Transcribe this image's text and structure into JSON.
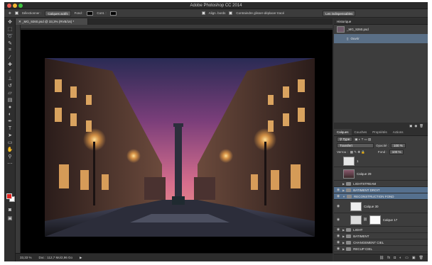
{
  "window": {
    "title": "Adobe Photoshop CC 2014"
  },
  "options": {
    "select_label": "Sélectionner :",
    "select_value": "Calques actifs",
    "fill_label": "Fond :",
    "stroke_label": "Cont. :",
    "align_label": "Align. bords",
    "constrain_label": "Contraindre glisser-déplacer tracé",
    "workspace_value": "Les indispensables"
  },
  "document": {
    "tab_title": "_MG_9260.psd @ 33,3% (RVB/16) *",
    "zoom": "33,33 %",
    "doc_info": "Doc : 112,7 Mo/2,96 Go"
  },
  "history": {
    "tab": "Historique",
    "snapshot": "_MG_9260.psd",
    "step": "Ouvrir"
  },
  "layers_panel": {
    "tabs": [
      "Calques",
      "Couches",
      "Propriétés",
      "Actions"
    ],
    "filter_value": "Type",
    "blend_value": "Transfert",
    "opacity_label": "Opacité :",
    "opacity_value": "100 %",
    "lock_label": "Verrou :",
    "fill_label": "Fond :",
    "fill_value": "100 %",
    "layers": [
      {
        "name": "1",
        "type": "layer",
        "thumb": "#e6e6e6",
        "selected": false
      },
      {
        "name": "Calque 29",
        "type": "layer",
        "thumb": "#7a4a4a",
        "selected": false
      },
      {
        "name": "LIGHTSTREAM",
        "type": "group",
        "selected": false
      },
      {
        "name": "BATIMENT DROIT",
        "type": "group",
        "selected": true
      },
      {
        "name": "RECONSTRUCTION FOND",
        "type": "group",
        "selected": true
      },
      {
        "name": "Calque 30",
        "type": "layer",
        "thumb": "#eeeeee",
        "selected": false
      },
      {
        "name": "Calque 17",
        "type": "masked",
        "thumb": "#dcdcdc",
        "selected": false
      },
      {
        "name": "LIGHT",
        "type": "group",
        "selected": false
      },
      {
        "name": "BATIMENT",
        "type": "group",
        "selected": false
      },
      {
        "name": "CHANGEMENT CIEL",
        "type": "group",
        "selected": false
      },
      {
        "name": "RECUP CIEL",
        "type": "group",
        "selected": false
      }
    ]
  }
}
